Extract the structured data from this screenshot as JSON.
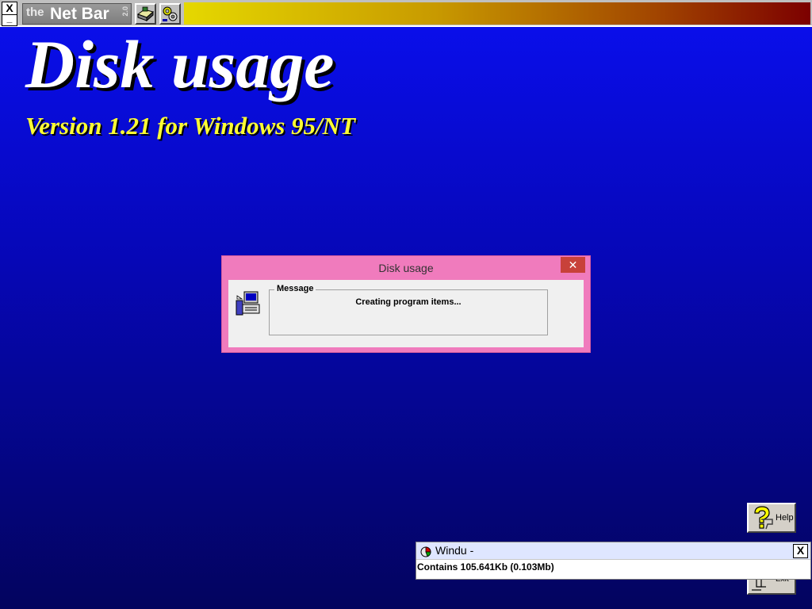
{
  "netbar": {
    "logo_the": "the",
    "logo_name": "Net Bar",
    "logo_version": "2.0",
    "close_glyph": "X",
    "minimize_glyph": "_",
    "buttons": [
      {
        "icon": "disk-drive-icon"
      },
      {
        "icon": "gears-icon"
      }
    ],
    "gradient_colors": [
      "#e5d800",
      "#7c0000"
    ]
  },
  "splash": {
    "title": "Disk usage",
    "subtitle": "Version 1.21 for Windows 95/NT",
    "title_color": "#ffffff",
    "subtitle_color": "#ffff33"
  },
  "dialog": {
    "title": "Disk usage",
    "close_glyph": "✕",
    "icon": "computer-setup-icon",
    "group_label": "Message",
    "message": "Creating program items...",
    "frame_color": "#f07bbd"
  },
  "help_button": {
    "label": "Help",
    "icon": "question-mark-icon"
  },
  "exit_button": {
    "label": "Exit",
    "icon": "door-exit-icon"
  },
  "windu": {
    "title": "Windu -",
    "close_glyph": "X",
    "icon": "disk-pie-icon",
    "status": "Contains 105.641Kb (0.103Mb)"
  }
}
